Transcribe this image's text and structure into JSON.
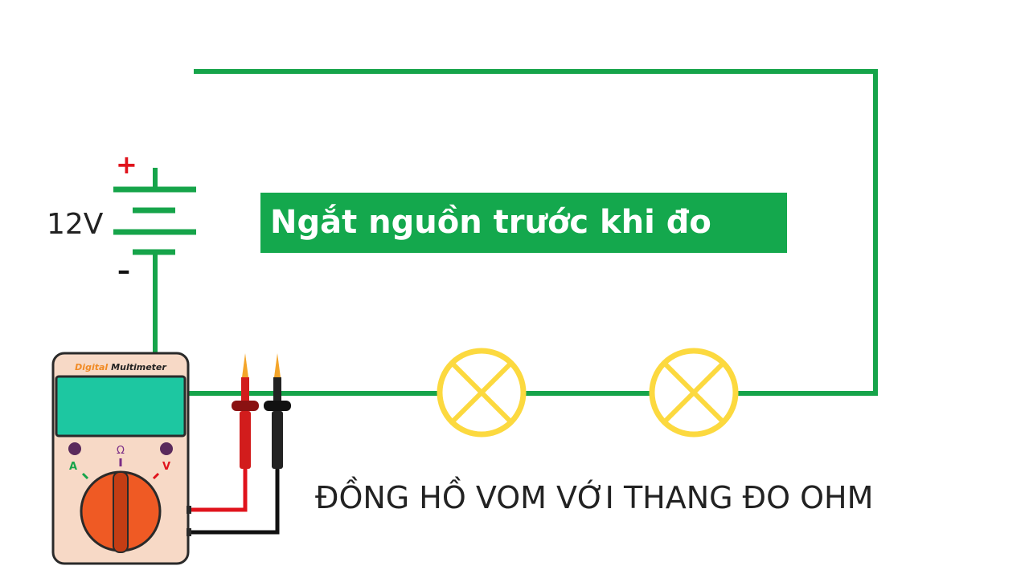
{
  "banner_text": "Ngắt nguồn trước khi đo",
  "caption": "ĐỒNG HỒ VOM VỚI THANG ĐO OHM",
  "battery": {
    "voltage": "12V",
    "plus": "+",
    "minus": "–"
  },
  "multimeter": {
    "brand_word1": "Digital",
    "brand_word2": "Multimeter",
    "mode_ohm": "Ω",
    "mode_amp": "A",
    "mode_volt": "V"
  },
  "colors": {
    "wire": "#16a44a",
    "lamp": "#fcd93f",
    "banner": "#14a84d",
    "probe_red": "#e0131c",
    "probe_black": "#111111",
    "meter_screen": "#1dc7a1",
    "meter_knob": "#ef5a24"
  },
  "components": {
    "lamps": 2,
    "probes": [
      "red",
      "black"
    ]
  }
}
